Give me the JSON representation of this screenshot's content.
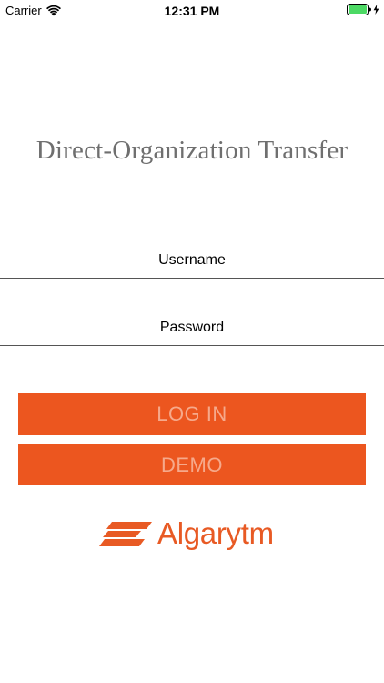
{
  "status_bar": {
    "carrier": "Carrier",
    "time": "12:31 PM",
    "wifi_icon": "wifi-icon",
    "battery_icon": "battery-full-icon",
    "charging_icon": "charging-bolt-icon",
    "battery_color": "#4cd964"
  },
  "title": "Direct-Organization Transfer",
  "form": {
    "username": {
      "placeholder": "Username",
      "value": ""
    },
    "password": {
      "placeholder": "Password",
      "value": ""
    }
  },
  "buttons": {
    "login_label": "LOG IN",
    "demo_label": "DEMO"
  },
  "logo": {
    "text": "Algarytm",
    "icon": "algarytm-logo-mark"
  },
  "colors": {
    "accent": "#ec561f",
    "button_text": "#f6a98b",
    "title_text": "#6f6f6f",
    "logo": "#e85a24"
  }
}
